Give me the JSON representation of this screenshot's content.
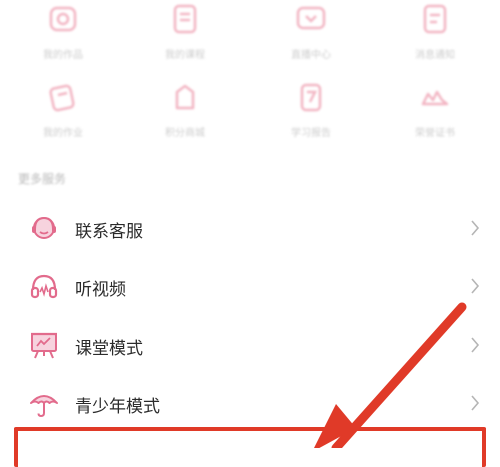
{
  "section_title": "更多服务",
  "service_grid": [
    {
      "label": "我的作品",
      "icon": "camera-icon"
    },
    {
      "label": "我的课程",
      "icon": "book-icon"
    },
    {
      "label": "直播中心",
      "icon": "tv-icon"
    },
    {
      "label": "消息通知",
      "icon": "document-icon"
    },
    {
      "label": "我的作业",
      "icon": "notebook-icon"
    },
    {
      "label": "积分商城",
      "icon": "gift-icon"
    },
    {
      "label": "学习报告",
      "icon": "report-icon"
    },
    {
      "label": "荣誉证书",
      "icon": "award-icon"
    }
  ],
  "menu": [
    {
      "label": "联系客服",
      "icon": "customer-service-icon"
    },
    {
      "label": "听视频",
      "icon": "headphones-icon"
    },
    {
      "label": "课堂模式",
      "icon": "presentation-board-icon"
    },
    {
      "label": "青少年模式",
      "icon": "umbrella-icon"
    }
  ],
  "colors": {
    "accent_pink": "#e26b8c",
    "annotation_red": "#e03a28",
    "chevron_gray": "#b5b5b5"
  }
}
